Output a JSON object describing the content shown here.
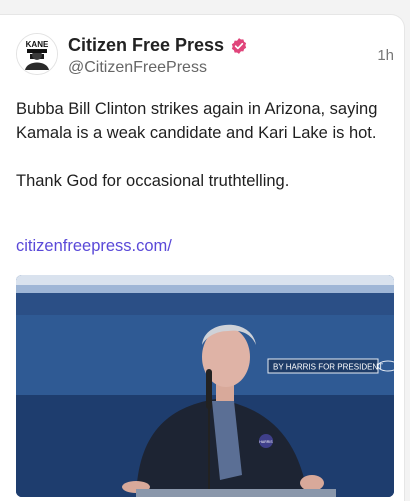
{
  "post": {
    "author_name": "Citizen Free Press",
    "handle": "@CitizenFreePress",
    "time": "1h",
    "avatar_text": "KANE",
    "verified_icon": "verified-badge-icon",
    "paragraphs": [
      "Bubba Bill Clinton strikes again in Arizona, saying Kamala is a weak candidate and Kari Lake is hot.",
      "Thank God for occasional truthtelling."
    ],
    "link_text": "citizenfreepress.com/",
    "media": {
      "banner_text": "BY HARRIS FOR PRESIDENT",
      "pin_text": "HARRIS"
    }
  },
  "colors": {
    "link": "#5a49d8",
    "verified": "#e0457b",
    "stage_blue": "#2b4f86"
  }
}
